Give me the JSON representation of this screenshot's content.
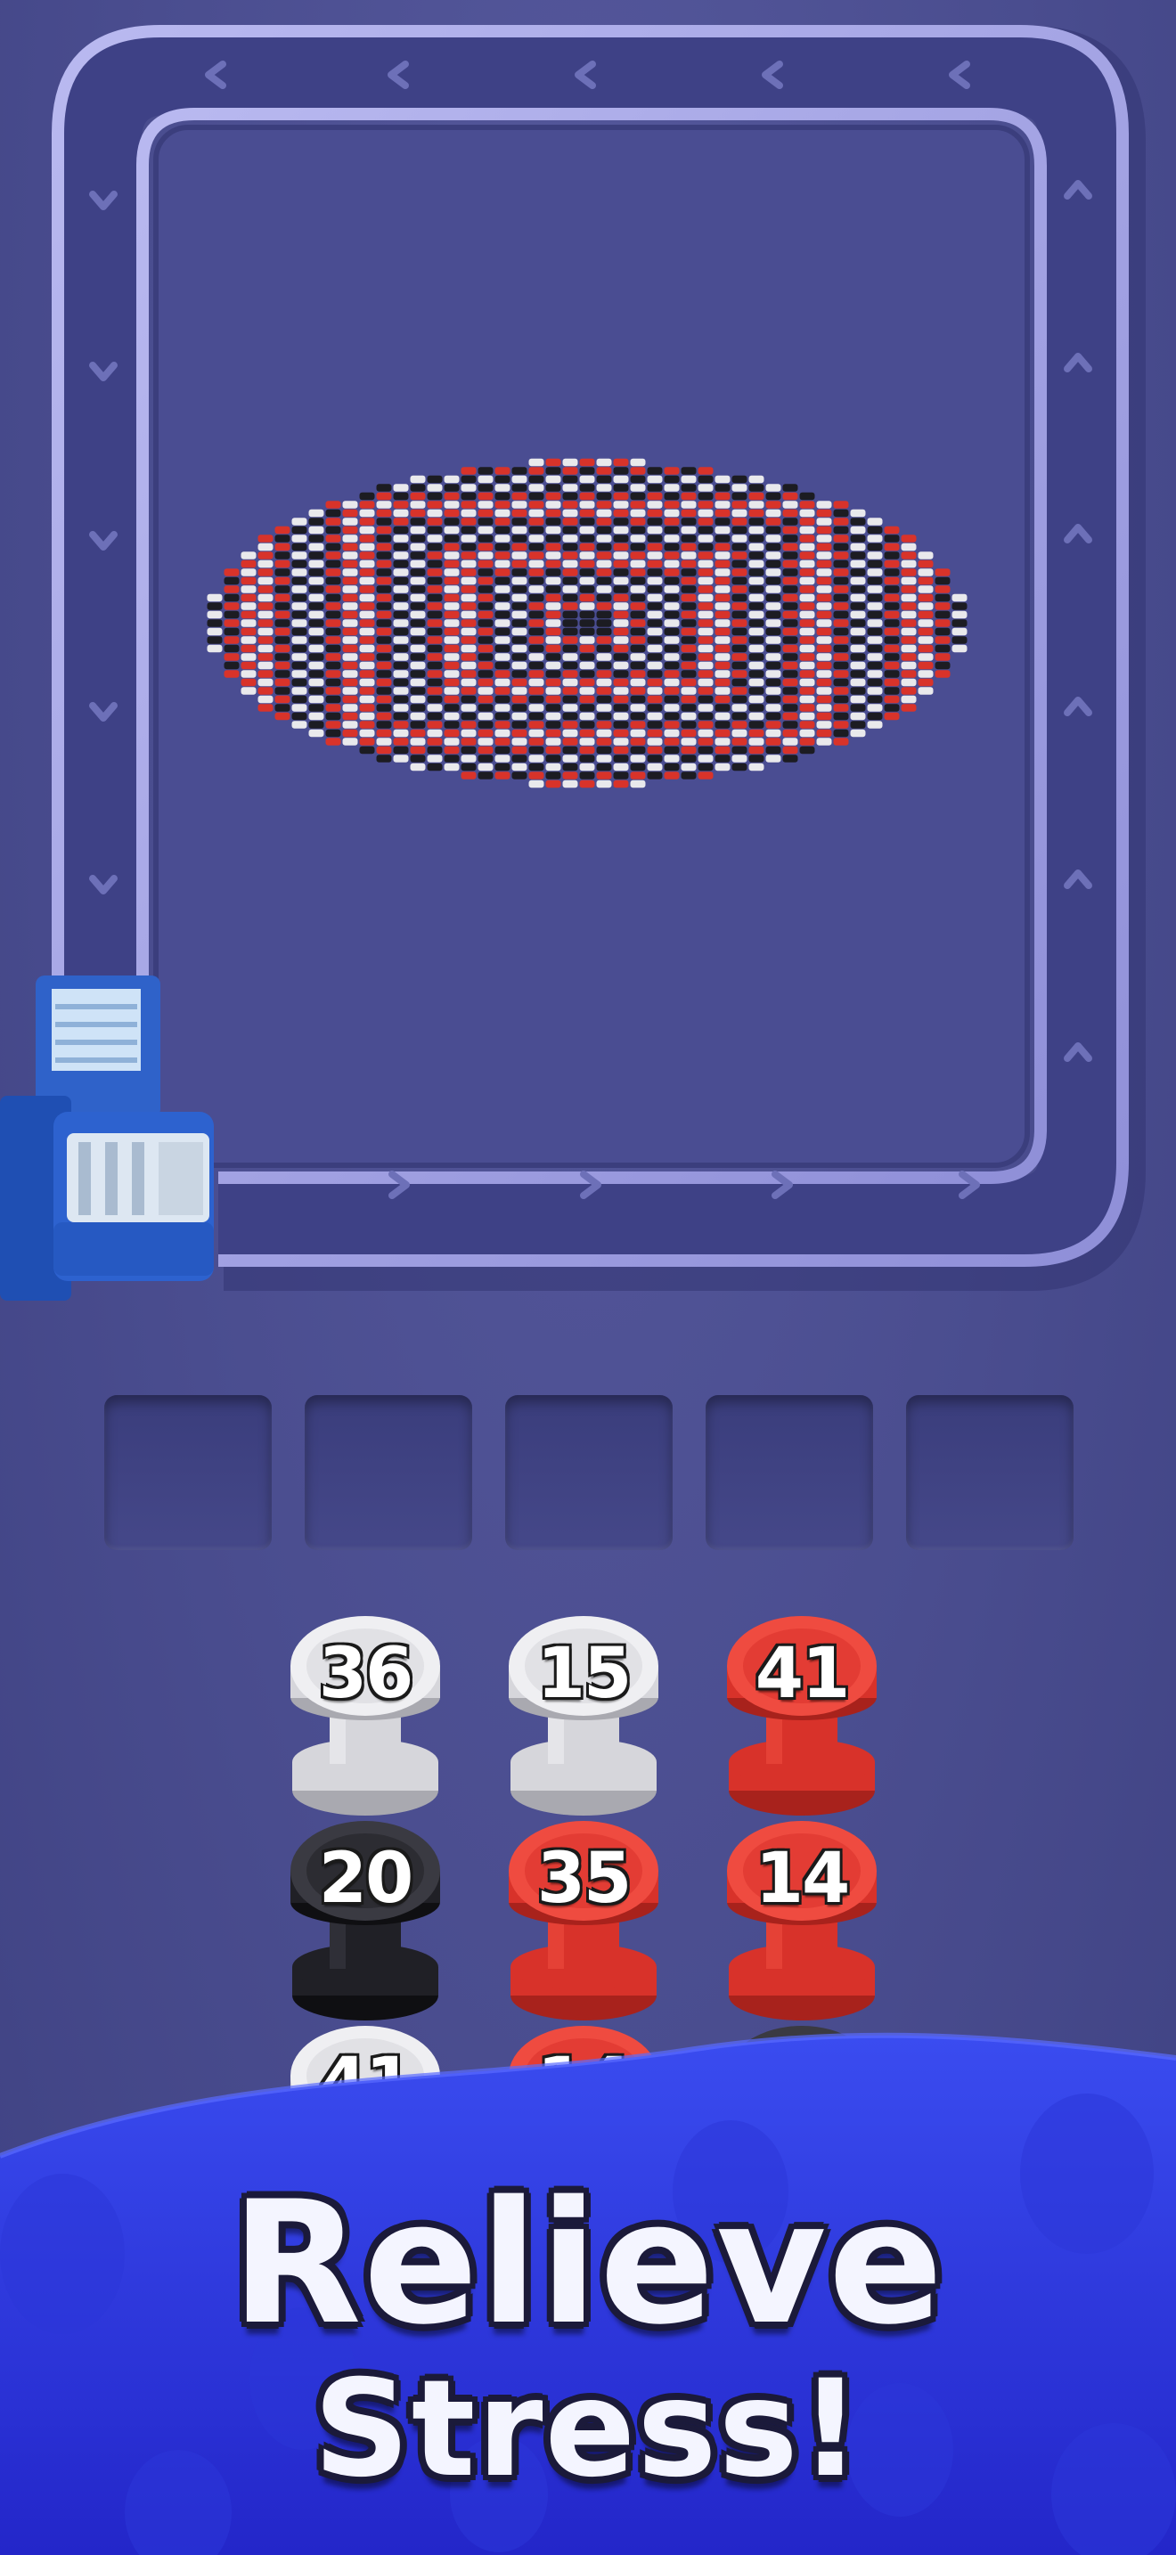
{
  "game": {
    "track": {
      "arrow_icon": "chevron-arrow-icon",
      "conveyor_icon": "spool-dispenser-icon"
    },
    "pixel_art": {
      "subject": "red-white-black concentric bead disc",
      "colors": {
        "red": "#d8332a",
        "white": "#e9e9ec",
        "black": "#1c1c22"
      }
    },
    "slots": {
      "count": 5
    },
    "spools": [
      {
        "number": "36",
        "color": "white"
      },
      {
        "number": "15",
        "color": "white"
      },
      {
        "number": "41",
        "color": "red"
      },
      {
        "number": "20",
        "color": "black"
      },
      {
        "number": "35",
        "color": "red"
      },
      {
        "number": "14",
        "color": "red"
      },
      {
        "number": "41",
        "color": "white"
      },
      {
        "number": "14",
        "color": "red"
      },
      {
        "number": "",
        "color": "black"
      }
    ]
  },
  "banner": {
    "line1": "Relieve",
    "line2": "Stress!",
    "colors": {
      "top": "#3a4cf0",
      "bottom": "#2326c9"
    },
    "bg_icon": "spool-pattern-icon"
  }
}
